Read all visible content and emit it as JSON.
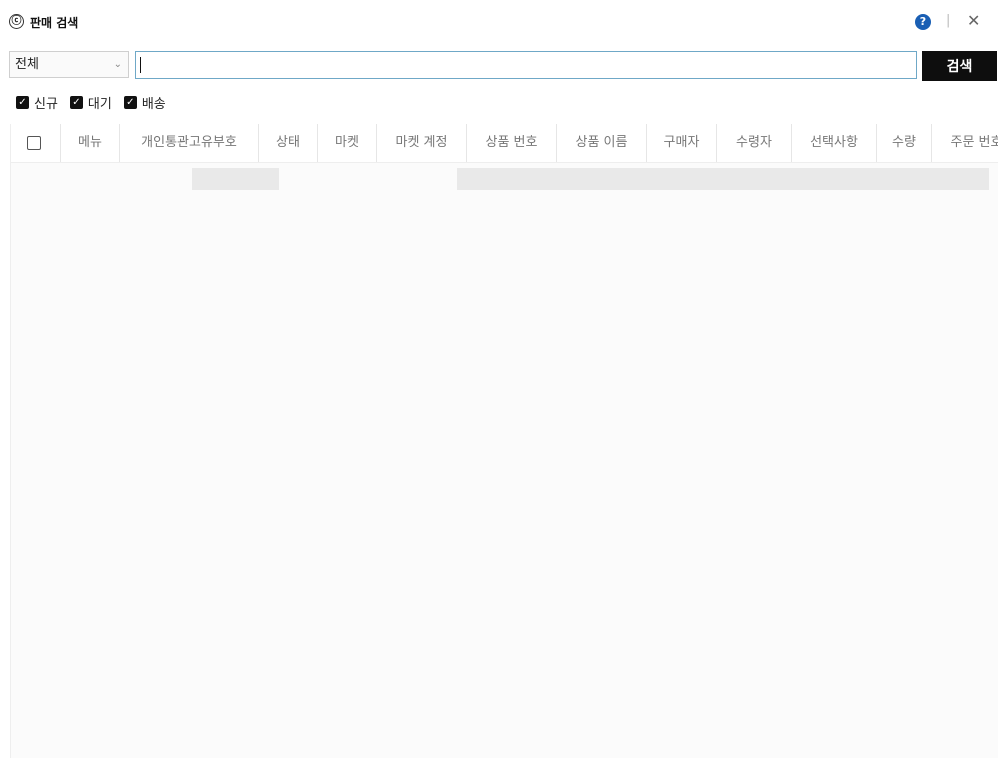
{
  "window": {
    "app_icon_glyph": "ⓒ",
    "title": "판매 검색",
    "help_glyph": "?",
    "separator": "|",
    "close_glyph": "✕"
  },
  "search": {
    "scope_selected": "전체",
    "scope_chevron": "⌄",
    "query_value": "",
    "button_label": "검색"
  },
  "filters": [
    {
      "label": "신규",
      "checked": true
    },
    {
      "label": "대기",
      "checked": true
    },
    {
      "label": "배송",
      "checked": true
    }
  ],
  "table": {
    "columns": [
      "메뉴",
      "개인통관고유부호",
      "상태",
      "마켓",
      "마켓 계정",
      "상품 번호",
      "상품 이름",
      "구매자",
      "수령자",
      "선택사항",
      "수량",
      "주문 번호"
    ],
    "rows": []
  },
  "colors": {
    "accent": "#1a5fb4",
    "search_button_bg": "#0e0e0e",
    "input_border": "#6fa8c7"
  }
}
